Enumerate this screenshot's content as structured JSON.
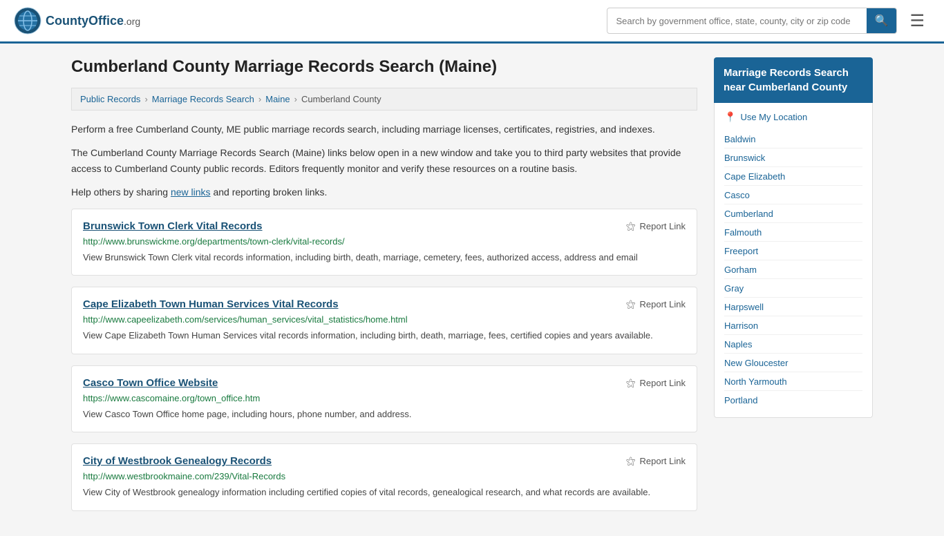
{
  "header": {
    "logo_text": "CountyOffice",
    "logo_suffix": ".org",
    "search_placeholder": "Search by government office, state, county, city or zip code"
  },
  "page": {
    "title": "Cumberland County Marriage Records Search (Maine)"
  },
  "breadcrumb": {
    "items": [
      {
        "label": "Public Records",
        "href": "#"
      },
      {
        "label": "Marriage Records Search",
        "href": "#"
      },
      {
        "label": "Maine",
        "href": "#"
      },
      {
        "label": "Cumberland County",
        "href": "#"
      }
    ]
  },
  "descriptions": [
    "Perform a free Cumberland County, ME public marriage records search, including marriage licenses, certificates, registries, and indexes.",
    "The Cumberland County Marriage Records Search (Maine) links below open in a new window and take you to third party websites that provide access to Cumberland County public records. Editors frequently monitor and verify these resources on a routine basis.",
    "Help others by sharing new links and reporting broken links."
  ],
  "new_links_label": "new links",
  "results": [
    {
      "title": "Brunswick Town Clerk Vital Records",
      "url": "http://www.brunswickme.org/departments/town-clerk/vital-records/",
      "description": "View Brunswick Town Clerk vital records information, including birth, death, marriage, cemetery, fees, authorized access, address and email",
      "report_label": "Report Link"
    },
    {
      "title": "Cape Elizabeth Town Human Services Vital Records",
      "url": "http://www.capeelizabeth.com/services/human_services/vital_statistics/home.html",
      "description": "View Cape Elizabeth Town Human Services vital records information, including birth, death, marriage, fees, certified copies and years available.",
      "report_label": "Report Link"
    },
    {
      "title": "Casco Town Office Website",
      "url": "https://www.cascomaine.org/town_office.htm",
      "description": "View Casco Town Office home page, including hours, phone number, and address.",
      "report_label": "Report Link"
    },
    {
      "title": "City of Westbrook Genealogy Records",
      "url": "http://www.westbrookmaine.com/239/Vital-Records",
      "description": "View City of Westbrook genealogy information including certified copies of vital records, genealogical research, and what records are available.",
      "report_label": "Report Link"
    }
  ],
  "sidebar": {
    "title": "Marriage Records Search near Cumberland County",
    "use_my_location": "Use My Location",
    "cities": [
      {
        "label": "Baldwin",
        "href": "#"
      },
      {
        "label": "Brunswick",
        "href": "#"
      },
      {
        "label": "Cape Elizabeth",
        "href": "#"
      },
      {
        "label": "Casco",
        "href": "#"
      },
      {
        "label": "Cumberland",
        "href": "#"
      },
      {
        "label": "Falmouth",
        "href": "#"
      },
      {
        "label": "Freeport",
        "href": "#"
      },
      {
        "label": "Gorham",
        "href": "#"
      },
      {
        "label": "Gray",
        "href": "#"
      },
      {
        "label": "Harpswell",
        "href": "#"
      },
      {
        "label": "Harrison",
        "href": "#"
      },
      {
        "label": "Naples",
        "href": "#"
      },
      {
        "label": "New Gloucester",
        "href": "#"
      },
      {
        "label": "North Yarmouth",
        "href": "#"
      },
      {
        "label": "Portland",
        "href": "#"
      }
    ]
  }
}
